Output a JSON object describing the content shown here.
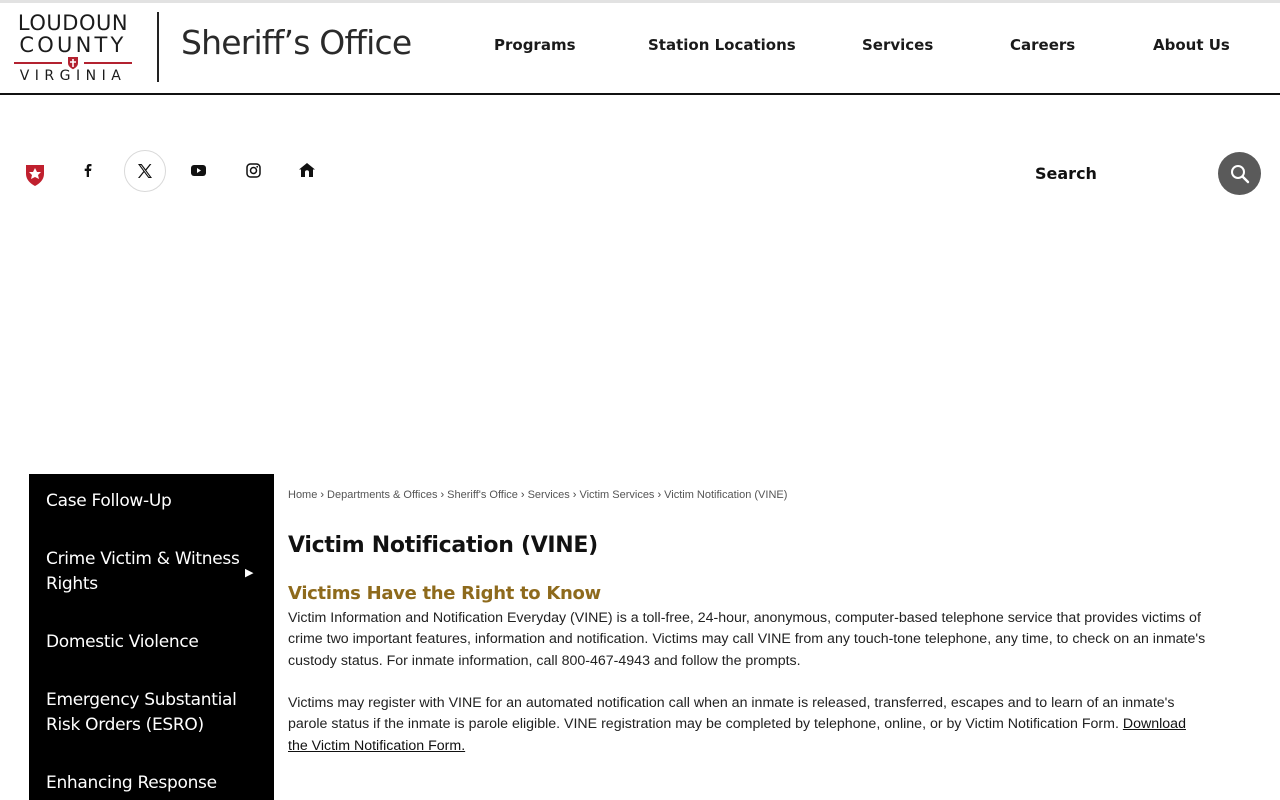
{
  "header": {
    "logo": {
      "line1": "LOUDOUN",
      "line2": "COUNTY",
      "line3": "VIRGINIA"
    },
    "brand": "Sheriff’s Office",
    "nav": [
      {
        "label": "Programs"
      },
      {
        "label": "Station Locations"
      },
      {
        "label": "Services"
      },
      {
        "label": "Careers"
      },
      {
        "label": "About Us"
      }
    ]
  },
  "social": {
    "icons": [
      "shield-icon",
      "facebook-icon",
      "x-icon",
      "youtube-icon",
      "instagram-icon",
      "nextdoor-icon"
    ]
  },
  "search": {
    "label": "Search",
    "icon": "search-icon"
  },
  "sidebar": {
    "items": [
      {
        "label": "Case Follow-Up"
      },
      {
        "label": "Crime Victim & Witness Rights"
      },
      {
        "label": "Domestic Violence"
      },
      {
        "label": "Emergency Substantial Risk Orders (ESRO)"
      },
      {
        "label": "Enhancing Response"
      }
    ],
    "arrow": "▶"
  },
  "breadcrumb": {
    "items": [
      "Home",
      "Departments & Offices",
      "Sheriff's Office",
      "Services",
      "Victim Services",
      "Victim Notification (VINE)"
    ],
    "separator": "›"
  },
  "main": {
    "title": "Victim Notification (VINE)",
    "subheading": "Victims Have the Right to Know",
    "para1": "Victim Information and Notification Everyday (VINE) is a toll-free, 24-hour, anonymous, computer-based telephone service that provides victims of crime two important features, information and notification. Victims may call VINE from any touch-tone telephone, any time, to check on an inmate's custody status. For inmate information, call 800-467-4943 and follow the prompts.",
    "para2_text": "Victims may register with VINE for an automated notification call when an inmate is released, transferred, escapes and to learn of an inmate's parole status if the inmate is parole eligible. VINE registration may be completed by telephone, online, or by Victim Notification Form. ",
    "para2_link": "Download the Victim Notification Form."
  },
  "colors": {
    "accent_gold": "#8e6a1c",
    "brand_red": "#b32230",
    "sidebar_bg": "#000000",
    "search_button": "#5a5a5a"
  }
}
